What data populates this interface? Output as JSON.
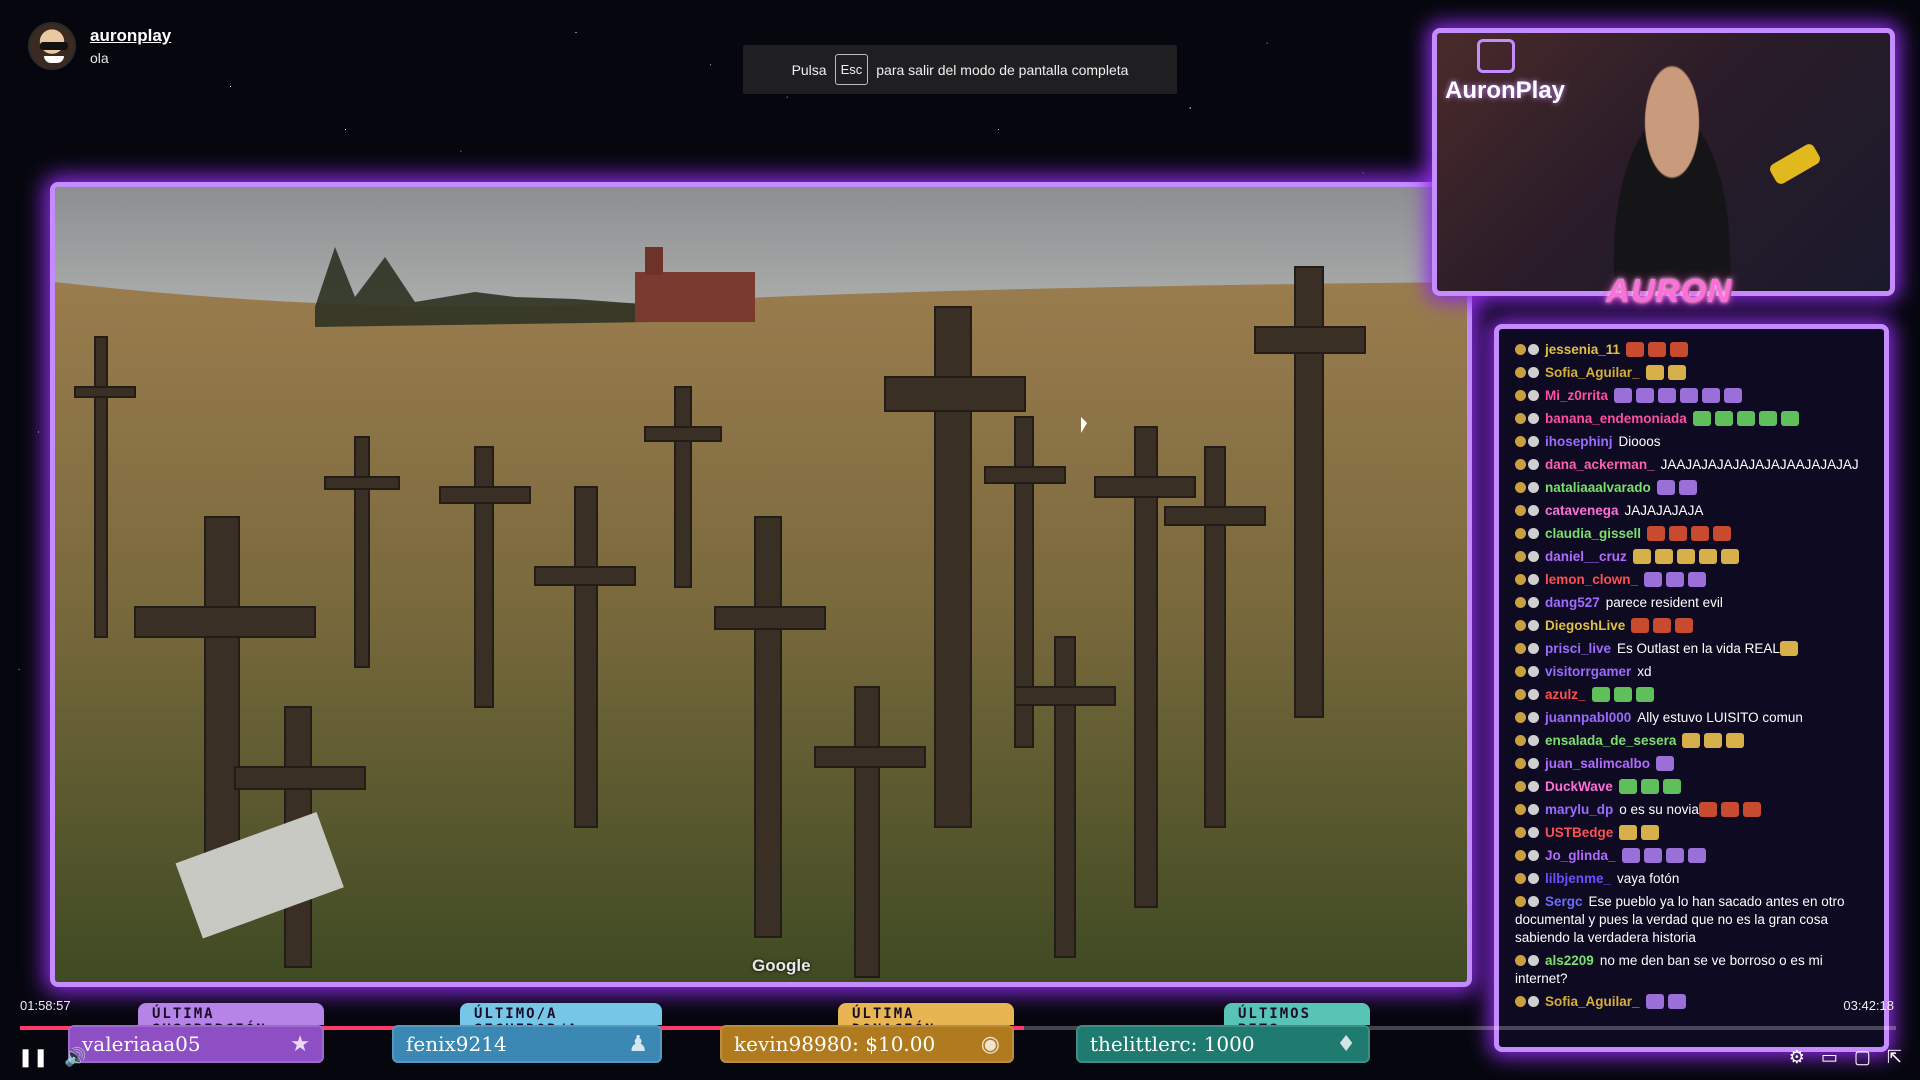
{
  "stream": {
    "channel_name": "auronplay",
    "status_text": "ola"
  },
  "fullscreen_notice": {
    "before": "Pulsa",
    "key": "Esc",
    "after": "para salir del modo de pantalla completa"
  },
  "video": {
    "watermark": "Google",
    "elapsed": "01:58:57",
    "duration": "03:42:18",
    "progress_fraction": 0.535
  },
  "webcam": {
    "brand_text": "AuronPlay",
    "label": "AURON"
  },
  "goals": [
    {
      "tab": "ÚLTIMA SUSCRIPCIÓN",
      "value": "valeriaaa05",
      "icon": "star-icon",
      "color": "#8e4fc4",
      "tab_color": "#b584e6"
    },
    {
      "tab": "ÚLTIMO/A SEGUIDOR/A",
      "value": "fenix9214",
      "icon": "person-icon",
      "color": "#3b88b4",
      "tab_color": "#76c6e8"
    },
    {
      "tab": "ÚLTIMA DONACIÓN",
      "value": "kevin98980: $10.00",
      "icon": "coin-icon",
      "color": "#b07a1e",
      "tab_color": "#e7b552"
    },
    {
      "tab": "ÚLTIMOS BITS",
      "value": "thelittlerc: 1000",
      "icon": "gem-icon",
      "color": "#1f7a70",
      "tab_color": "#58c4b6"
    }
  ],
  "chat": [
    {
      "user": "jessenia_11",
      "color": "#e0c044",
      "text": "",
      "emotes": 3
    },
    {
      "user": "Sofia_Aguilar_",
      "color": "#d6b03a",
      "text": "",
      "emotes": 2
    },
    {
      "user": "Mi_z0rrita",
      "color": "#ff4fa2",
      "text": "",
      "emotes": 6
    },
    {
      "user": "banana_endemoniada",
      "color": "#ff4fa2",
      "text": "",
      "emotes": 5
    },
    {
      "user": "ihosephinj",
      "color": "#9b6bff",
      "text": "Diooos",
      "emotes": 0
    },
    {
      "user": "dana_ackerman_",
      "color": "#ff5fb0",
      "text": "JAAJAJAJAJAJAJAJAAJAJAJAJ",
      "emotes": 0
    },
    {
      "user": "nataliaaalvarado",
      "color": "#7be06b",
      "text": "",
      "emotes": 2
    },
    {
      "user": "catavenega",
      "color": "#ff6fd8",
      "text": "JAJAJAJAJA",
      "emotes": 0
    },
    {
      "user": "claudia_gissell",
      "color": "#7be06b",
      "text": "",
      "emotes": 4
    },
    {
      "user": "daniel__cruz",
      "color": "#b36bff",
      "text": "",
      "emotes": 5
    },
    {
      "user": "lemon_clown_",
      "color": "#ff4f4f",
      "text": "",
      "emotes": 3
    },
    {
      "user": "dang527",
      "color": "#a36bff",
      "text": "parece resident evil",
      "emotes": 0
    },
    {
      "user": "DiegoshLive",
      "color": "#e0c044",
      "text": "",
      "emotes": 3
    },
    {
      "user": "prisci_live",
      "color": "#9b6bff",
      "text": "Es Outlast en la vida REAL",
      "emotes": 1
    },
    {
      "user": "visitorrgamer",
      "color": "#9b6bff",
      "text": "xd",
      "emotes": 0
    },
    {
      "user": "azulz_",
      "color": "#ff4f4f",
      "text": "",
      "emotes": 3
    },
    {
      "user": "juannpabl000",
      "color": "#9b6bff",
      "text": "Ally estuvo LUISITO comun",
      "emotes": 0
    },
    {
      "user": "ensalada_de_sesera",
      "color": "#7be06b",
      "text": "",
      "emotes": 3
    },
    {
      "user": "juan_salimcalbo",
      "color": "#b36bff",
      "text": "",
      "emotes": 1
    },
    {
      "user": "DuckWave",
      "color": "#ff6fd8",
      "text": "",
      "emotes": 3
    },
    {
      "user": "marylu_dp",
      "color": "#9b6bff",
      "text": "o es su novia",
      "emotes": 3
    },
    {
      "user": "USTBedge",
      "color": "#ff4f4f",
      "text": "",
      "emotes": 2
    },
    {
      "user": "Jo_glinda_",
      "color": "#b36bff",
      "text": "",
      "emotes": 4
    },
    {
      "user": "lilbjenme_",
      "color": "#6b4fff",
      "text": "vaya fotón",
      "emotes": 0
    },
    {
      "user": "Sergc",
      "color": "#6b6bff",
      "text": "Ese pueblo ya lo han sacado antes en otro documental y pues la verdad que no es la gran cosa sabiendo la verdadera historia",
      "emotes": 0
    },
    {
      "user": "als2209",
      "color": "#7be06b",
      "text": "no me den ban se ve borroso o es mi internet?",
      "emotes": 0
    },
    {
      "user": "Sofia_Aguilar_",
      "color": "#d6b03a",
      "text": "",
      "emotes": 2
    }
  ],
  "player_controls": {
    "pause_icon": "pause-icon",
    "volume_icon": "volume-icon",
    "settings_icon": "gear-icon",
    "cast_icon": "cast-icon",
    "theater_icon": "theater-icon",
    "exit_fullscreen_icon": "exit-fullscreen-icon"
  }
}
